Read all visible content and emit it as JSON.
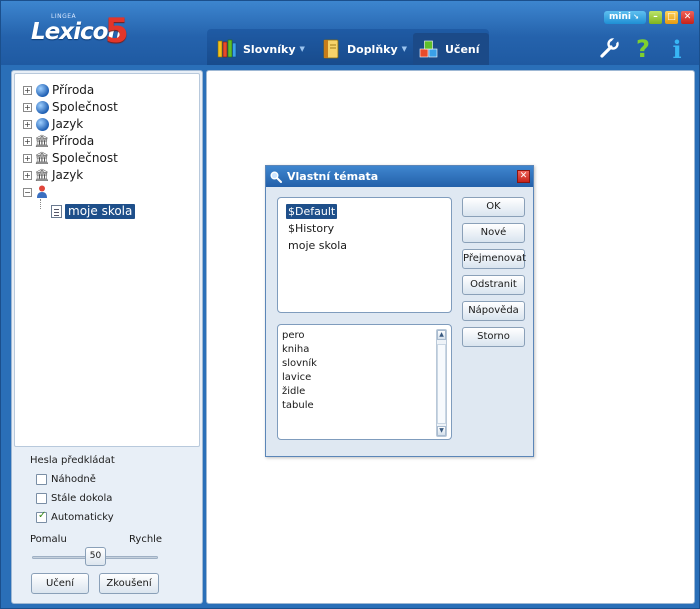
{
  "app": {
    "logo_small": "LINGEA",
    "logo_text": "Lexicon",
    "logo_number": "5",
    "mini_label": "mini",
    "colors": {
      "header": "#2a6fb8",
      "accent_red": "#e2362a",
      "help_green": "#7fd02f",
      "info_blue": "#38b6f5",
      "selection": "#1e4f8a"
    }
  },
  "menu": {
    "slovniky": "Slovníky",
    "doplnky": "Doplňky",
    "uceni": "Učení",
    "icons": [
      "books-icon",
      "notebook-icon",
      "abc-blocks-icon"
    ]
  },
  "tools": {
    "help_glyph": "?",
    "info_glyph": "i",
    "icons": [
      "wrench-icon",
      "help-icon",
      "info-icon"
    ]
  },
  "tree": {
    "items": [
      {
        "label": "Příroda",
        "icon": "globe-icon"
      },
      {
        "label": "Společnost",
        "icon": "globe-icon"
      },
      {
        "label": "Jazyk",
        "icon": "globe-icon"
      },
      {
        "label": "Příroda",
        "icon": "temple-icon"
      },
      {
        "label": "Společnost",
        "icon": "temple-icon"
      },
      {
        "label": "Jazyk",
        "icon": "temple-icon"
      }
    ],
    "user_node_icon": "user-icon",
    "child": {
      "label": "moje skola",
      "icon": "document-icon"
    }
  },
  "options": {
    "title": "Hesla předkládat",
    "checkboxes": [
      {
        "label": "Náhodně",
        "checked": false
      },
      {
        "label": "Stále dokola",
        "checked": false
      },
      {
        "label": "Automaticky",
        "checked": true
      }
    ],
    "slider": {
      "min_label": "Pomalu",
      "max_label": "Rychle",
      "value": "50"
    },
    "buttons": {
      "uceni": "Učení",
      "zkouseni": "Zkoušení"
    }
  },
  "dialog": {
    "title": "Vlastní témata",
    "close_glyph": "✕",
    "topics": [
      {
        "label": "$Default",
        "selected": true
      },
      {
        "label": "$History",
        "selected": false
      },
      {
        "label": "moje skola",
        "selected": false
      }
    ],
    "words": [
      "pero",
      "kniha",
      "slovník",
      "lavice",
      "židle",
      "tabule"
    ],
    "buttons": {
      "ok": "OK",
      "nove": "Nové",
      "prejmenovat": "Přejmenovat",
      "odstranit": "Odstranit",
      "napoveda": "Nápověda",
      "storno": "Storno"
    }
  }
}
